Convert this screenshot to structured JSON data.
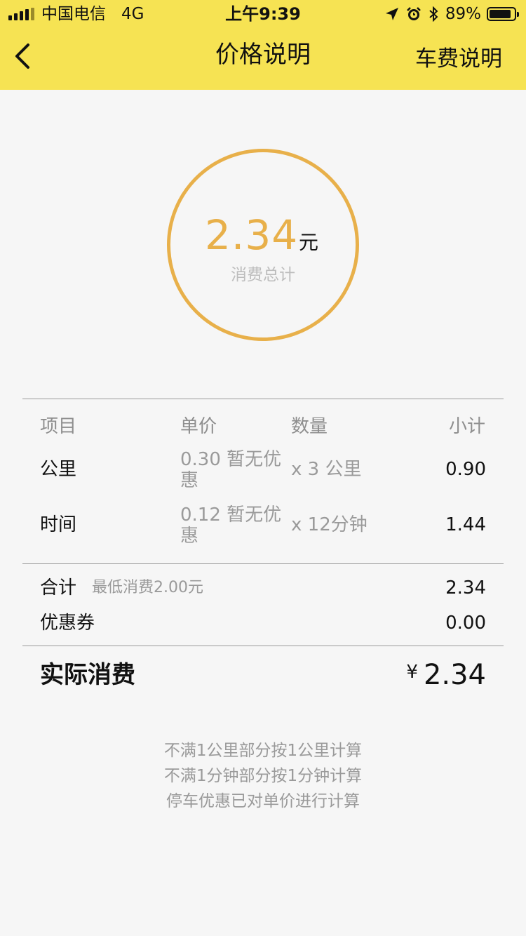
{
  "status_bar": {
    "carrier": "中国电信",
    "network": "4G",
    "time": "上午9:39",
    "battery": "89%",
    "battery_level": 0.89,
    "icons": [
      "signal-icon",
      "location-arrow-icon",
      "alarm-icon",
      "bluetooth-icon",
      "battery-icon"
    ]
  },
  "nav": {
    "back_icon": "chevron-left-icon",
    "title": "价格说明",
    "right_label": "车费说明"
  },
  "total": {
    "amount": "2.34",
    "unit": "元",
    "label": "消费总计",
    "ring_color": "#e8b04a"
  },
  "table": {
    "headers": [
      "项目",
      "单价",
      "数量",
      "小计"
    ],
    "rows": [
      {
        "item": "公里",
        "unit_price": "0.30 暂无优惠",
        "quantity": "x 3 公里",
        "subtotal": "0.90"
      },
      {
        "item": "时间",
        "unit_price": "0.12 暂无优惠",
        "quantity": "x 12分钟",
        "subtotal": "1.44"
      }
    ]
  },
  "summary": {
    "sum_label": "合计",
    "sum_note": "最低消费2.00元",
    "sum_value": "2.34",
    "coupon_label": "优惠券",
    "coupon_value": "0.00"
  },
  "actual": {
    "label": "实际消费",
    "currency": "¥",
    "value": "2.34"
  },
  "notes": [
    "不满1公里部分按1公里计算",
    "不满1分钟部分按1分钟计算",
    "停车优惠已对单价进行计算"
  ],
  "colors": {
    "header_bg": "#f6e353",
    "accent": "#e8b04a",
    "page_bg": "#f6f6f6"
  }
}
